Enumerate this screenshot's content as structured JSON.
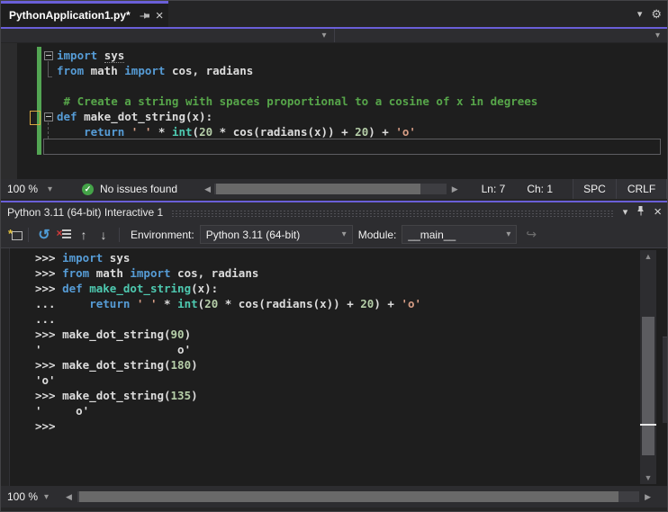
{
  "colors": {
    "accent_purple": "#6A5FD8",
    "keyword_blue": "#569CD6",
    "function_teal": "#4EC9B0",
    "string_red": "#D69D85",
    "number_green": "#B5CEA8",
    "comment_green": "#57A64A",
    "change_bar_green": "#53A553",
    "change_bar_yellow": "#D7A73F",
    "status_check_green": "#44A348"
  },
  "icons": {
    "chevron_down": "▾",
    "close": "×",
    "gear": "⚙",
    "check": "✓",
    "reset": "↺",
    "arrow_up": "↑",
    "arrow_down": "↓",
    "redo": "↪",
    "scroll_left": "◀",
    "scroll_right": "▶",
    "scroll_up": "▲",
    "scroll_down": "▼",
    "clear_x": "×",
    "env_spark": "*"
  },
  "tab": {
    "title": "PythonApplication1.py*"
  },
  "editor": {
    "lines": [
      [
        [
          "k",
          "import"
        ],
        [
          "p",
          " "
        ],
        [
          "u",
          "sys"
        ]
      ],
      [
        [
          "k",
          "from"
        ],
        [
          "p",
          " math "
        ],
        [
          "k",
          "import"
        ],
        [
          "p",
          " cos, radians"
        ]
      ],
      [],
      [
        [
          "c",
          " # Create a string with spaces proportional to a cosine of x in degrees"
        ]
      ],
      [
        [
          "k",
          "def"
        ],
        [
          "p",
          " make_dot_string(x):"
        ]
      ],
      [
        [
          "p",
          "    "
        ],
        [
          "k",
          "return"
        ],
        [
          "p",
          " "
        ],
        [
          "s",
          "' '"
        ],
        [
          "p",
          " * "
        ],
        [
          "f",
          "int"
        ],
        [
          "p",
          "("
        ],
        [
          "n",
          "20"
        ],
        [
          "p",
          " * cos(radians(x)) + "
        ],
        [
          "n",
          "20"
        ],
        [
          "p",
          ") + "
        ],
        [
          "s",
          "'o'"
        ]
      ],
      []
    ]
  },
  "editor_status": {
    "zoom": "100 %",
    "issues": "No issues found",
    "line": "Ln: 7",
    "column": "Ch: 1",
    "spaces": "SPC",
    "line_ending": "CRLF"
  },
  "interactive": {
    "title": "Python 3.11 (64-bit) Interactive 1",
    "toolbar": {
      "environment_label": "Environment:",
      "environment_value": "Python 3.11 (64-bit)",
      "module_label": "Module:",
      "module_value": "__main__"
    },
    "lines": [
      [
        [
          "p",
          ">>> "
        ],
        [
          "k",
          "import"
        ],
        [
          "p",
          " sys"
        ]
      ],
      [
        [
          "p",
          ">>> "
        ],
        [
          "k",
          "from"
        ],
        [
          "p",
          " math "
        ],
        [
          "k",
          "import"
        ],
        [
          "p",
          " cos, radians"
        ]
      ],
      [
        [
          "p",
          ">>> "
        ],
        [
          "k",
          "def"
        ],
        [
          "p",
          " "
        ],
        [
          "f",
          "make_dot_string"
        ],
        [
          "p",
          "(x):"
        ]
      ],
      [
        [
          "p",
          "...     "
        ],
        [
          "k",
          "return"
        ],
        [
          "p",
          " "
        ],
        [
          "s",
          "' '"
        ],
        [
          "p",
          " * "
        ],
        [
          "f",
          "int"
        ],
        [
          "p",
          "("
        ],
        [
          "n",
          "20"
        ],
        [
          "p",
          " * cos(radians(x)) + "
        ],
        [
          "n",
          "20"
        ],
        [
          "p",
          ") + "
        ],
        [
          "s",
          "'o'"
        ]
      ],
      [
        [
          "p",
          "..."
        ]
      ],
      [
        [
          "p",
          ">>> make_dot_string("
        ],
        [
          "n",
          "90"
        ],
        [
          "p",
          ")"
        ]
      ],
      [
        [
          "p",
          "'                    o'"
        ]
      ],
      [
        [
          "p",
          ">>> make_dot_string("
        ],
        [
          "n",
          "180"
        ],
        [
          "p",
          ")"
        ]
      ],
      [
        [
          "p",
          "'o'"
        ]
      ],
      [
        [
          "p",
          ">>> make_dot_string("
        ],
        [
          "n",
          "135"
        ],
        [
          "p",
          ")"
        ]
      ],
      [
        [
          "p",
          "'     o'"
        ]
      ],
      [
        [
          "p",
          ">>> "
        ]
      ]
    ],
    "status": {
      "zoom": "100 %"
    }
  }
}
